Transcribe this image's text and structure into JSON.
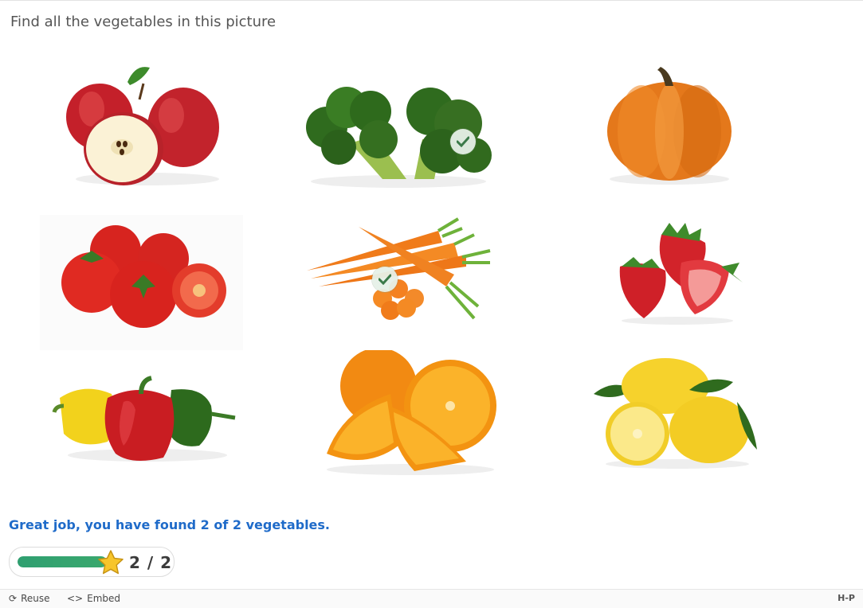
{
  "task": {
    "description": "Find all the vegetables in this picture"
  },
  "images": [
    {
      "name": "apples",
      "is_vegetable": false,
      "found": false
    },
    {
      "name": "broccoli",
      "is_vegetable": true,
      "found": true
    },
    {
      "name": "pumpkin",
      "is_vegetable": false,
      "found": false
    },
    {
      "name": "tomatoes",
      "is_vegetable": false,
      "found": false
    },
    {
      "name": "carrots",
      "is_vegetable": true,
      "found": true
    },
    {
      "name": "strawberries",
      "is_vegetable": false,
      "found": false
    },
    {
      "name": "peppers",
      "is_vegetable": false,
      "found": false
    },
    {
      "name": "oranges",
      "is_vegetable": false,
      "found": false
    },
    {
      "name": "lemons",
      "is_vegetable": false,
      "found": false
    }
  ],
  "feedback": {
    "text": "Great job, you have found 2 of 2 vegetables."
  },
  "score": {
    "current": 2,
    "max": 2,
    "label": "2 / 2",
    "progress_fraction": 1.0,
    "fill_color": "#2f9f70",
    "icon": "star-icon"
  },
  "footer": {
    "reuse_label": "Reuse",
    "embed_label": "Embed",
    "logo_text": "H-P",
    "reuse_icon": "refresh-icon",
    "embed_icon": "code-icon"
  },
  "colors": {
    "feedback_text": "#1f6bc9",
    "task_text": "#555555",
    "check_bg": "#e6f0e8",
    "check_mark": "#3b7a4a"
  }
}
